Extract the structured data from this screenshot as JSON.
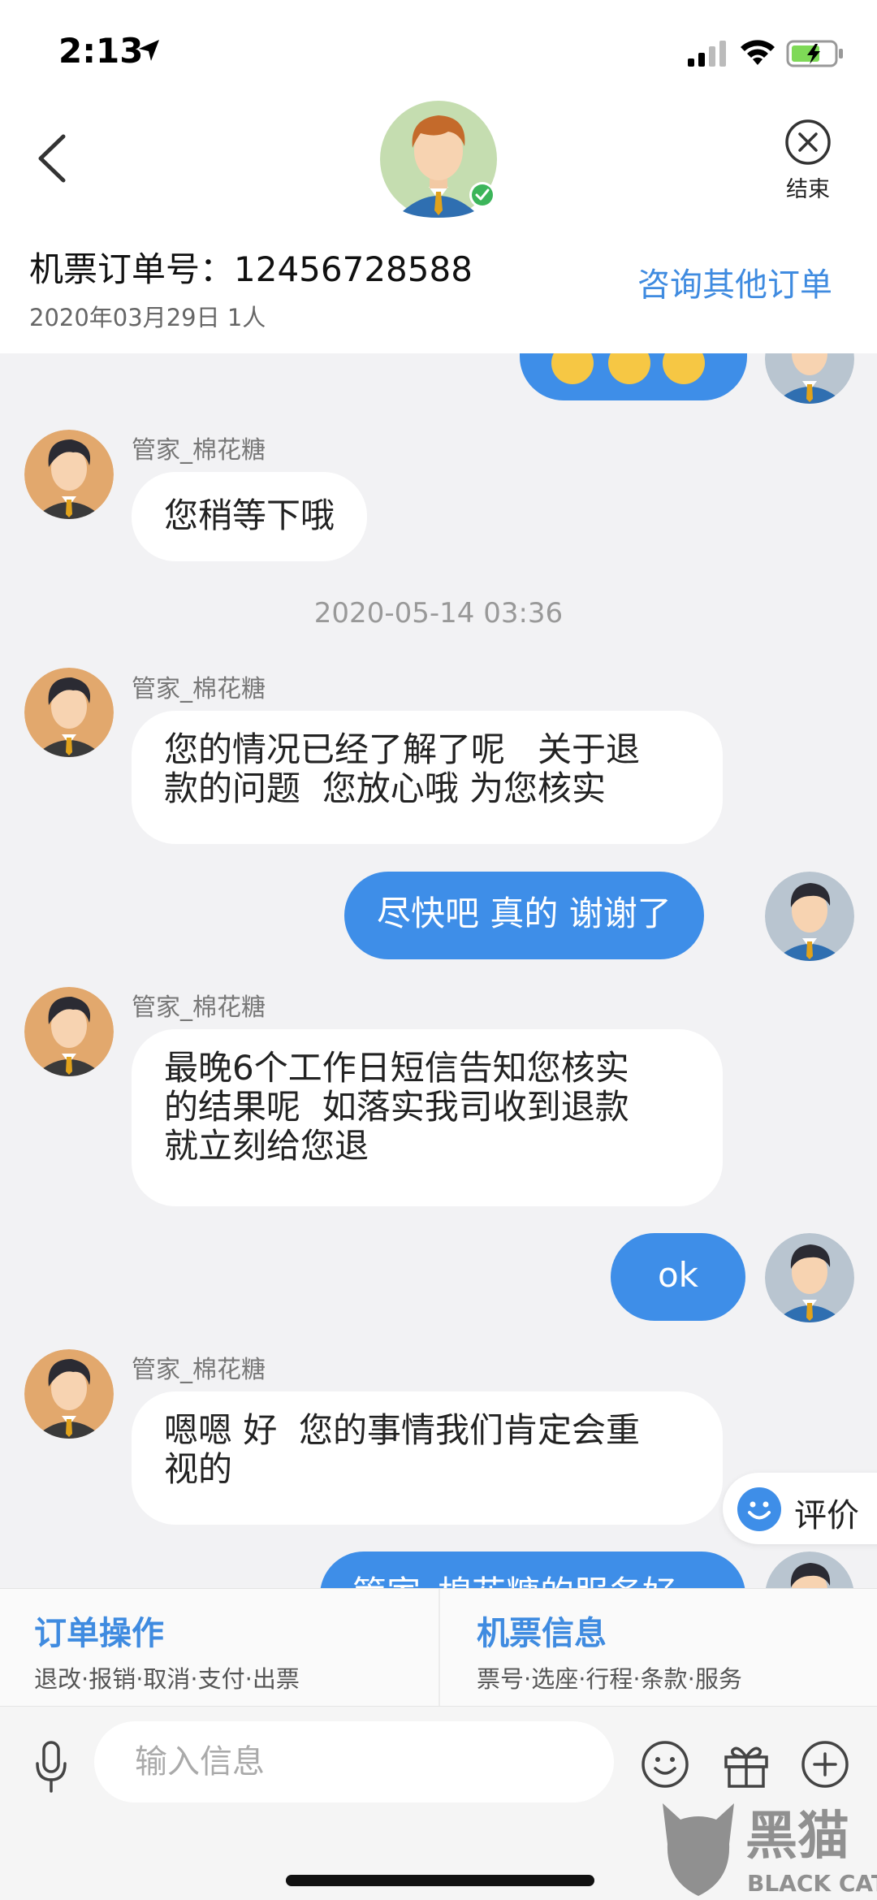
{
  "status": {
    "time": "2:13"
  },
  "header": {
    "end_label": "结束",
    "order_label": "机票订单号：12456728588",
    "order_meta": "2020年03月29日 1人",
    "other_orders": "咨询其他订单"
  },
  "chat": {
    "messages": [
      {
        "sender": "管家_棉花糖",
        "text": "您稍等下哦"
      },
      {
        "timestamp": "2020-05-14  03:36"
      },
      {
        "sender": "管家_棉花糖",
        "lines": [
          "您的情况已经了解了呢   关于退",
          "款的问题  您放心哦 为您核实"
        ]
      },
      {
        "outgoing": "尽快吧 真的 谢谢了"
      },
      {
        "sender": "管家_棉花糖",
        "lines": [
          "最晚6个工作日短信告知您核实",
          "的结果呢  如落实我司收到退款",
          "就立刻给您退"
        ]
      },
      {
        "outgoing": "ok"
      },
      {
        "sender": "管家_棉花糖",
        "lines": [
          "嗯嗯 好  您的事情我们肯定会重",
          "视的"
        ]
      },
      {
        "outgoing": "管家_棉花糖的服务好"
      }
    ],
    "rate_label": "评价"
  },
  "actions": {
    "order_ops": {
      "title": "订单操作",
      "subtitle": "退改·报销·取消·支付·出票"
    },
    "ticket_info": {
      "title": "机票信息",
      "subtitle": "票号·选座·行程·条款·服务"
    }
  },
  "input": {
    "placeholder": "输入信息"
  },
  "watermark": {
    "text_cn": "黑猫",
    "text_en": "BLACK CAT"
  },
  "colors": {
    "accent": "#3e8ee8",
    "background": "#f2f2f4"
  }
}
